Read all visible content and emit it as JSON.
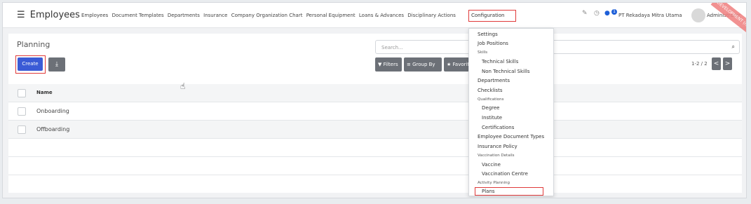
{
  "app": {
    "menu_icon": "hamburger-icon",
    "title": "Employees"
  },
  "nav": {
    "items": [
      "Employees",
      "Document Templates",
      "Departments",
      "Insurance",
      "Company Organization Chart",
      "Personal Equipment",
      "Loans & Advances",
      "Disciplinary Actions"
    ],
    "config": "Configuration"
  },
  "systray": {
    "edit_icon": "edit-icon",
    "clock_icon": "clock-icon",
    "chat_icon": "chat-icon",
    "chat_count": "1",
    "company": "PT Rekadaya Mitra Utama",
    "user": "Administrator",
    "ribbon": "DEVELOPMENT (rekadaya)"
  },
  "page": {
    "breadcrumb": "Planning",
    "search_placeholder": "Search...",
    "create": "Create",
    "download_icon": "download-icon",
    "filters": "Filters",
    "group_by": "Group By",
    "favorites": "Favorites",
    "pager": "1-2 / 2",
    "prev": "<",
    "next": ">"
  },
  "table": {
    "column": "Name",
    "rows": [
      "Onboarding",
      "Offboarding"
    ]
  },
  "dropdown": {
    "settings": "Settings",
    "job_positions": "Job Positions",
    "skills": "Skills",
    "technical_skills": "Technical Skills",
    "non_technical_skills": "Non Technical Skills",
    "departments": "Departments",
    "checklists": "Checklists",
    "qualifications": "Qualifications",
    "degree": "Degree",
    "institute": "Institute",
    "certifications": "Certifications",
    "employee_document_types": "Employee Document Types",
    "insurance_policy": "Insurance Policy",
    "vaccination_details": "Vaccination Details",
    "vaccine": "Vaccine",
    "vaccination_centre": "Vaccination Centre",
    "activity_planning": "Activity Planning",
    "plans": "Plans"
  },
  "colors": {
    "primary": "#3b5bd6",
    "highlight": "#e03a3a",
    "button": "#6c7077"
  }
}
